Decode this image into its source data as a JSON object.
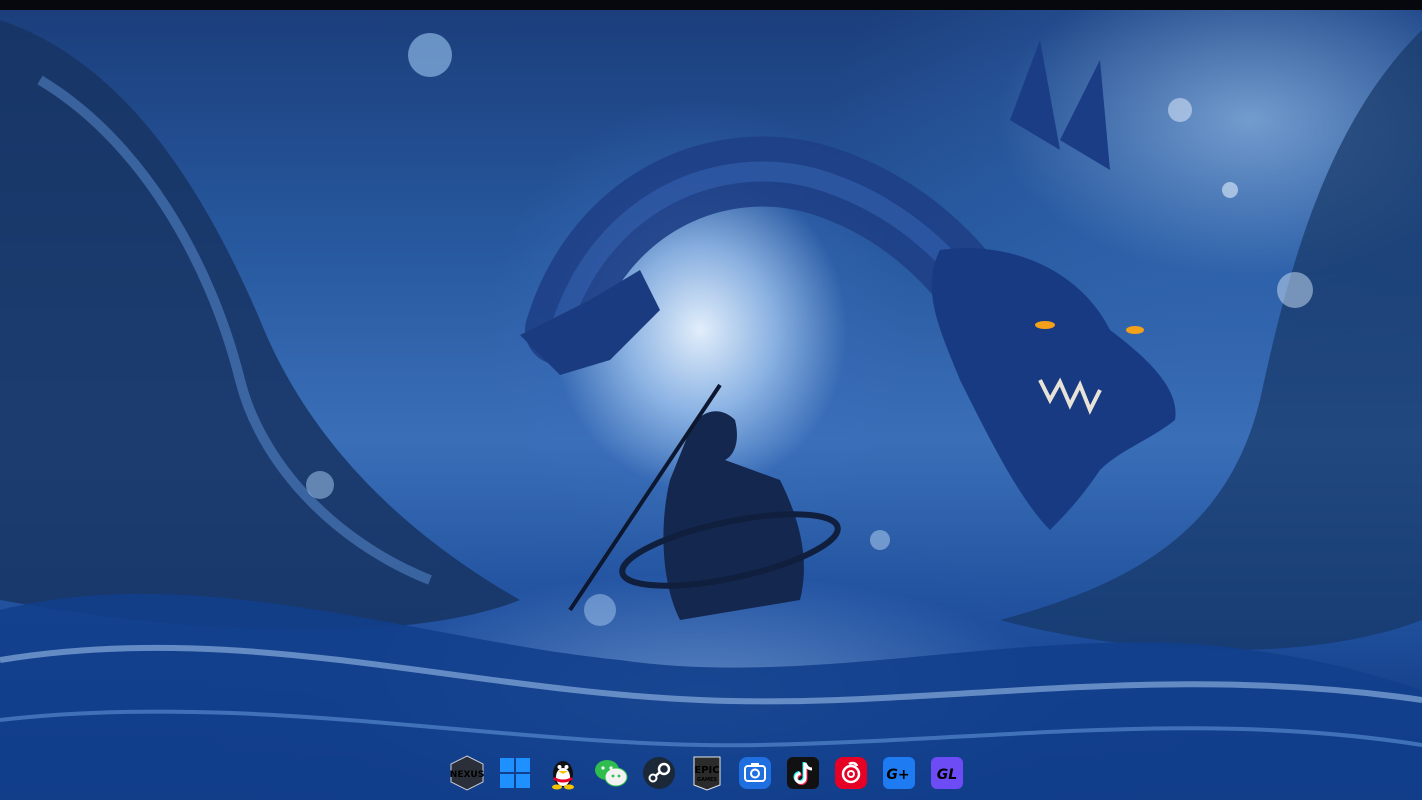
{
  "taskbar": {
    "apps": [
      {
        "id": "nexus",
        "label": "NEXUS",
        "icon": "nexus-icon"
      },
      {
        "id": "windows",
        "label": "",
        "icon": "windows-icon"
      },
      {
        "id": "qq",
        "label": "",
        "icon": "qq-penguin-icon"
      },
      {
        "id": "wechat",
        "label": "",
        "icon": "wechat-icon"
      },
      {
        "id": "steam",
        "label": "",
        "icon": "steam-icon"
      },
      {
        "id": "epic",
        "label_top": "EPIC",
        "label_bottom": "GAMES",
        "icon": "epic-games-icon"
      },
      {
        "id": "screenshot",
        "label": "",
        "icon": "camera-icon"
      },
      {
        "id": "tiktok",
        "label": "",
        "icon": "tiktok-icon"
      },
      {
        "id": "netease-music",
        "label": "",
        "icon": "netease-music-icon"
      },
      {
        "id": "gplus",
        "label": "G+",
        "icon": "gplus-icon"
      },
      {
        "id": "gl",
        "label": "GL",
        "icon": "gl-icon"
      }
    ]
  },
  "colors": {
    "windows_blue": "#1e90ff",
    "qq_yellow": "#f6c300",
    "wechat_green": "#2ebd4e",
    "steam_navy": "#1b2838",
    "tiktok_black": "#111111",
    "netease_red": "#e60026",
    "gplus_blue": "#1f7bf2",
    "gl_purple": "#6d4cf5"
  }
}
